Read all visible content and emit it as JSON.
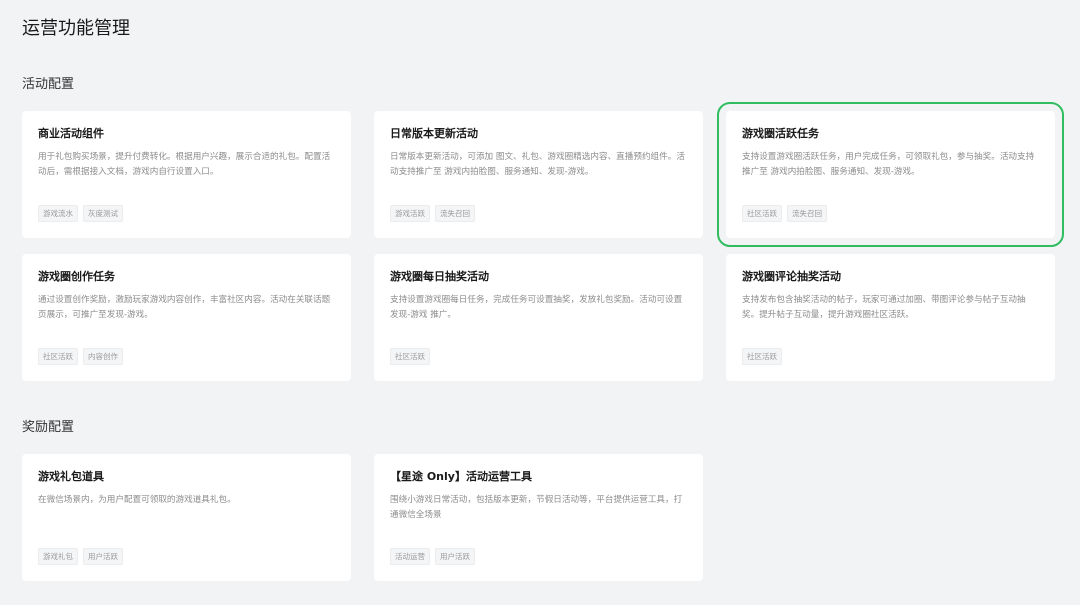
{
  "page": {
    "title": "运营功能管理"
  },
  "sections": [
    {
      "title": "活动配置",
      "cards": [
        {
          "title": "商业活动组件",
          "desc": "用于礼包购买场景，提升付费转化。根据用户兴趣，展示合适的礼包。配置活动后，需根据接入文档，游戏内自行设置入口。",
          "tags": [
            "游戏流水",
            "灰度测试"
          ]
        },
        {
          "title": "日常版本更新活动",
          "desc": "日常版本更新活动，可添加 图文、礼包、游戏圈精选内容、直播预约组件。活动支持推广至 游戏内拍脸图、服务通知、发现-游戏。",
          "tags": [
            "游戏活跃",
            "流失召回"
          ]
        },
        {
          "title": "游戏圈活跃任务",
          "desc": "支持设置游戏圈活跃任务，用户完成任务，可领取礼包，参与抽奖。活动支持推广至 游戏内拍脸图、服务通知、发现-游戏。",
          "tags": [
            "社区活跃",
            "流失召回"
          ],
          "selected": true
        },
        {
          "title": "游戏圈创作任务",
          "desc": "通过设置创作奖励，激励玩家游戏内容创作，丰富社区内容。活动在关联话题页展示，可推广至发现-游戏。",
          "tags": [
            "社区活跃",
            "内容创作"
          ]
        },
        {
          "title": "游戏圈每日抽奖活动",
          "desc": "支持设置游戏圈每日任务，完成任务可设置抽奖，发放礼包奖励。活动可设置 发现-游戏 推广。",
          "tags": [
            "社区活跃"
          ]
        },
        {
          "title": "游戏圈评论抽奖活动",
          "desc": "支持发布包含抽奖活动的帖子，玩家可通过加圈、带图评论参与帖子互动抽奖。提升帖子互动量，提升游戏圈社区活跃。",
          "tags": [
            "社区活跃"
          ]
        }
      ]
    },
    {
      "title": "奖励配置",
      "cards": [
        {
          "title": "游戏礼包道具",
          "desc": "在微信场景内，为用户配置可领取的游戏道具礼包。",
          "tags": [
            "游戏礼包",
            "用户活跃"
          ]
        },
        {
          "title": "【星途 Only】活动运营工具",
          "desc": "围绕小游戏日常活动，包括版本更新，节假日活动等，平台提供运营工具，打通微信全场景",
          "tags": [
            "活动运营",
            "用户活跃"
          ]
        }
      ]
    }
  ]
}
